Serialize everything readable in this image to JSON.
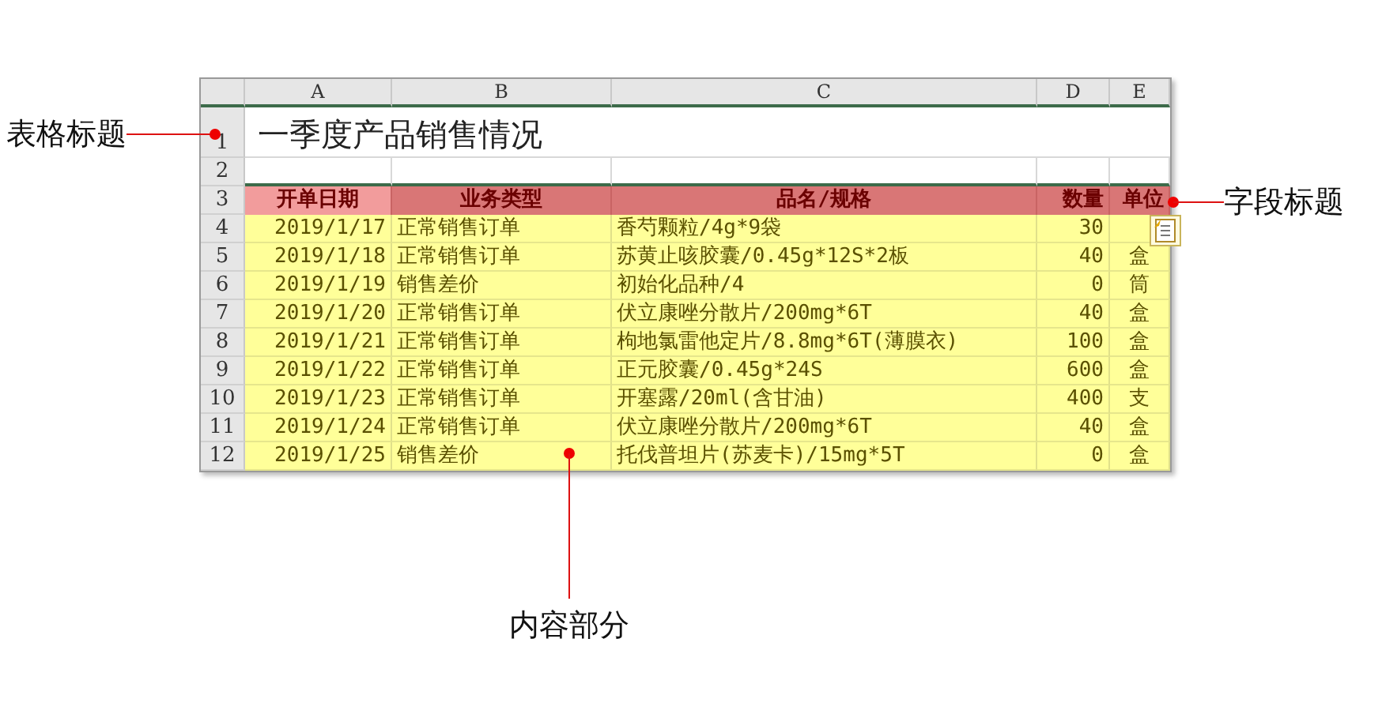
{
  "sheet": {
    "columns": [
      "A",
      "B",
      "C",
      "D",
      "E"
    ],
    "row_numbers": [
      "1",
      "2",
      "3",
      "4",
      "5",
      "6",
      "7",
      "8",
      "9",
      "10",
      "11",
      "12"
    ],
    "title": "一季度产品销售情况",
    "header": [
      "开单日期",
      "业务类型",
      "品名/规格",
      "数量",
      "单位"
    ],
    "rows": [
      [
        "2019/1/17",
        "正常销售订单",
        "香芍颗粒/4g*9袋",
        "30"
      ],
      [
        "2019/1/18",
        "正常销售订单",
        "苏黄止咳胶囊/0.45g*12S*2板",
        "40",
        "盒"
      ],
      [
        "2019/1/19",
        "销售差价",
        "初始化品种/4",
        "0",
        "筒"
      ],
      [
        "2019/1/20",
        "正常销售订单",
        "伏立康唑分散片/200mg*6T",
        "40",
        "盒"
      ],
      [
        "2019/1/21",
        "正常销售订单",
        "枸地氯雷他定片/8.8mg*6T(薄膜衣)",
        "100",
        "盒"
      ],
      [
        "2019/1/22",
        "正常销售订单",
        "正元胶囊/0.45g*24S",
        "600",
        "盒"
      ],
      [
        "2019/1/23",
        "正常销售订单",
        "开塞露/20ml(含甘油)",
        "400",
        "支"
      ],
      [
        "2019/1/24",
        "正常销售订单",
        "伏立康唑分散片/200mg*6T",
        "40",
        "盒"
      ],
      [
        "2019/1/25",
        "销售差价",
        "托伐普坦片(苏麦卡)/15mg*5T",
        "0",
        "盒"
      ]
    ]
  },
  "callouts": [
    {
      "kind": "left",
      "label": "表格标题"
    },
    {
      "kind": "right",
      "label": "字段标题"
    },
    {
      "kind": "bottom",
      "label": "内容部分"
    }
  ]
}
